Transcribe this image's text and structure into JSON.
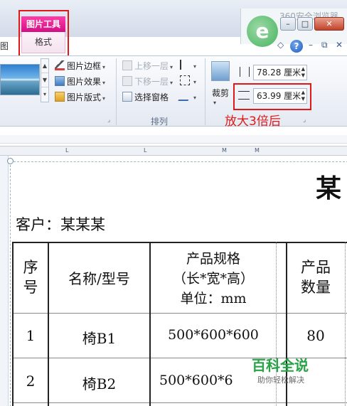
{
  "ribbon_tabs": {
    "left_partial": "图",
    "context_group": "图片工具",
    "context_tab": "格式"
  },
  "overlay": {
    "text": "360安全浏览器"
  },
  "window_buttons": {
    "minimize": "–",
    "maximize": "□",
    "close": "✕"
  },
  "help_row": {
    "chevron": "◇",
    "help": "?",
    "restore": "⧉",
    "close": "✕"
  },
  "picture_styles": {
    "border": "图片边框",
    "effects": "图片效果",
    "layout": "图片版式"
  },
  "arrange": {
    "bring_forward": "上移一层",
    "send_backward": "下移一层",
    "selection_pane": "选择窗格",
    "group_label": "排列"
  },
  "size": {
    "crop_label": "裁剪",
    "height_value": "78.28 厘米",
    "width_value": "63.99 厘米"
  },
  "annotation": "放大3倍后",
  "ruler": {
    "marks": [
      "L",
      "L",
      "M",
      "M"
    ]
  },
  "document": {
    "partial_title": "某",
    "customer": "客户：某某某",
    "headers": {
      "seq": [
        "序",
        "号"
      ],
      "name": "名称/型号",
      "spec": [
        "产品规格",
        "（长*宽*高）",
        "单位：mm"
      ],
      "qty": [
        "产品",
        "数量"
      ]
    },
    "rows": [
      {
        "seq": "1",
        "name": "椅B1",
        "spec": "500*600*600",
        "qty": "80"
      },
      {
        "seq": "2",
        "name": "椅B2",
        "spec": "500*600*6",
        "qty": ""
      }
    ]
  },
  "watermark": {
    "title": "百科全说",
    "subtitle": "助你轻松解决"
  },
  "colors": {
    "highlight": "#e01818",
    "context_tab": "#d40f86",
    "watermark": "#27a447"
  }
}
